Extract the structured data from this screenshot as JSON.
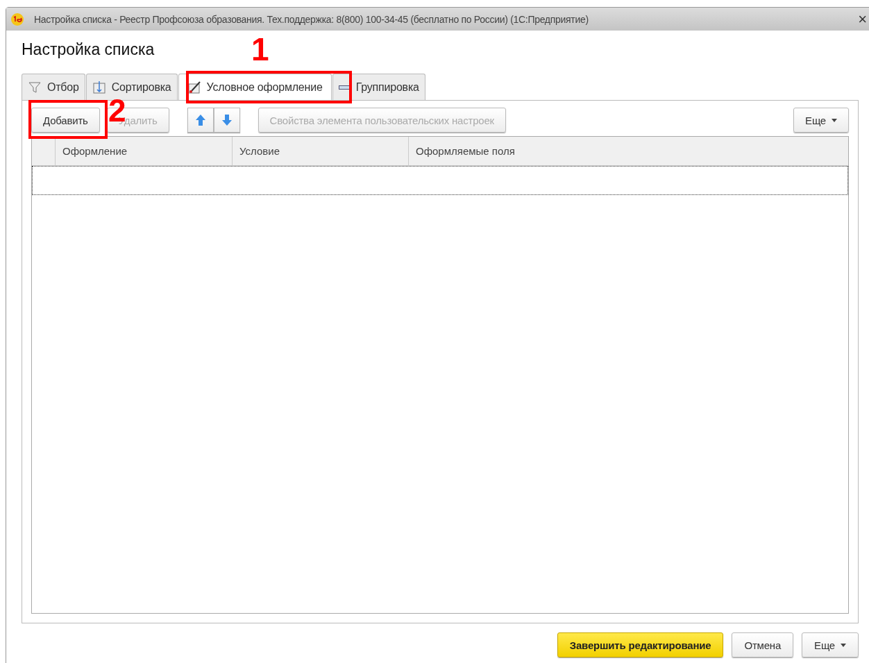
{
  "window": {
    "title": "Настройка списка - Реестр Профсоюза образования. Тех.поддержка: 8(800) 100-34-45 (бесплатно по России)  (1С:Предприятие)",
    "close": "×"
  },
  "heading": "Настройка списка",
  "tabs": [
    {
      "label": "Отбор",
      "selected": false,
      "kind": "filter"
    },
    {
      "label": "Сортировка",
      "selected": false,
      "kind": "sort"
    },
    {
      "label": "Условное оформление",
      "selected": true,
      "kind": "brush"
    },
    {
      "label": "Группировка",
      "selected": false,
      "kind": "group"
    }
  ],
  "toolbar": {
    "add": {
      "label": "Добавить",
      "disabled": false
    },
    "delete": {
      "label": "Удалить",
      "disabled": true
    },
    "properties": {
      "label": "Свойства элемента пользовательских настроек",
      "disabled": true
    },
    "more": "Еще"
  },
  "table": {
    "columns": [
      "Оформление",
      "Условие",
      "Оформляемые поля"
    ],
    "rows": [
      {
        "selected": true
      }
    ]
  },
  "footer": {
    "finish": "Завершить редактирование",
    "cancel": "Отмена",
    "more": "Еще"
  },
  "annotations": [
    "1",
    "2"
  ]
}
